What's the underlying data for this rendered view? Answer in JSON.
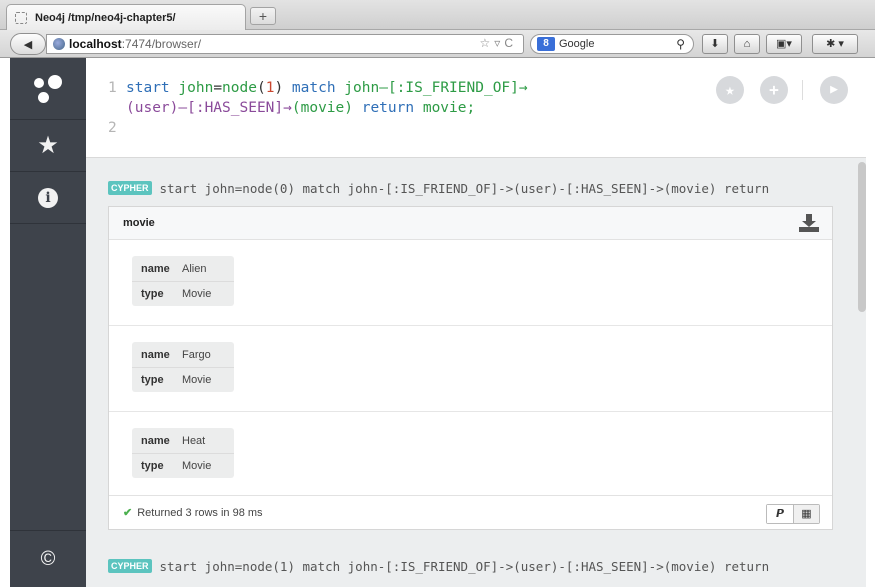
{
  "browser": {
    "tab_title": "Neo4j /tmp/neo4j-chapter5/",
    "new_tab_label": "+",
    "url_host": "localhost",
    "url_rest": ":7474/browser/",
    "search_engine_badge": "8",
    "search_placeholder": "Google"
  },
  "editor": {
    "line1_no": "1",
    "line2_no": "2",
    "code_line1": {
      "kw_start": "start",
      "var_john": "john",
      "op_eq": "=",
      "fn_node": "node",
      "paren_open": "(",
      "num_1": "1",
      "paren_close": ")",
      "kw_match": "match",
      "rest": "john–[:IS_FRIEND_OF]→"
    },
    "code_line1_cont": {
      "rel_user": "(user)–[:HAS_SEEN]→",
      "rel_movie": "(movie)",
      "kw_return": "return",
      "ret_var": "movie;"
    }
  },
  "frames": [
    {
      "badge": "CYPHER",
      "query": "start john=node(0) match john-[:IS_FRIEND_OF]->(user)-[:HAS_SEEN]->(movie) return"
    },
    {
      "badge": "CYPHER",
      "query": "start john=node(1) match john-[:IS_FRIEND_OF]->(user)-[:HAS_SEEN]->(movie) return"
    }
  ],
  "result": {
    "column": "movie",
    "rows": [
      {
        "name_key": "name",
        "name_val": "Alien",
        "type_key": "type",
        "type_val": "Movie"
      },
      {
        "name_key": "name",
        "name_val": "Fargo",
        "type_key": "type",
        "type_val": "Movie"
      },
      {
        "name_key": "name",
        "name_val": "Heat",
        "type_key": "type",
        "type_val": "Movie"
      }
    ],
    "status": "Returned 3 rows in 98 ms"
  },
  "icons": {
    "sidebar": [
      "neo4j-logo-icon",
      "star-icon",
      "info-icon",
      "copyright-icon"
    ],
    "editor_actions": [
      "favorite-icon",
      "add-icon",
      "play-icon"
    ],
    "frame": [
      "download-icon",
      "check-icon",
      "text-view-icon",
      "table-view-icon"
    ]
  },
  "colors": {
    "sidebar_bg": "#3e434b",
    "cypher_badge": "#5cc4bf",
    "keyword_blue": "#2f6fb7",
    "function_green": "#2d9b45",
    "number_red": "#c9472f",
    "success_green": "#4bb04f"
  }
}
